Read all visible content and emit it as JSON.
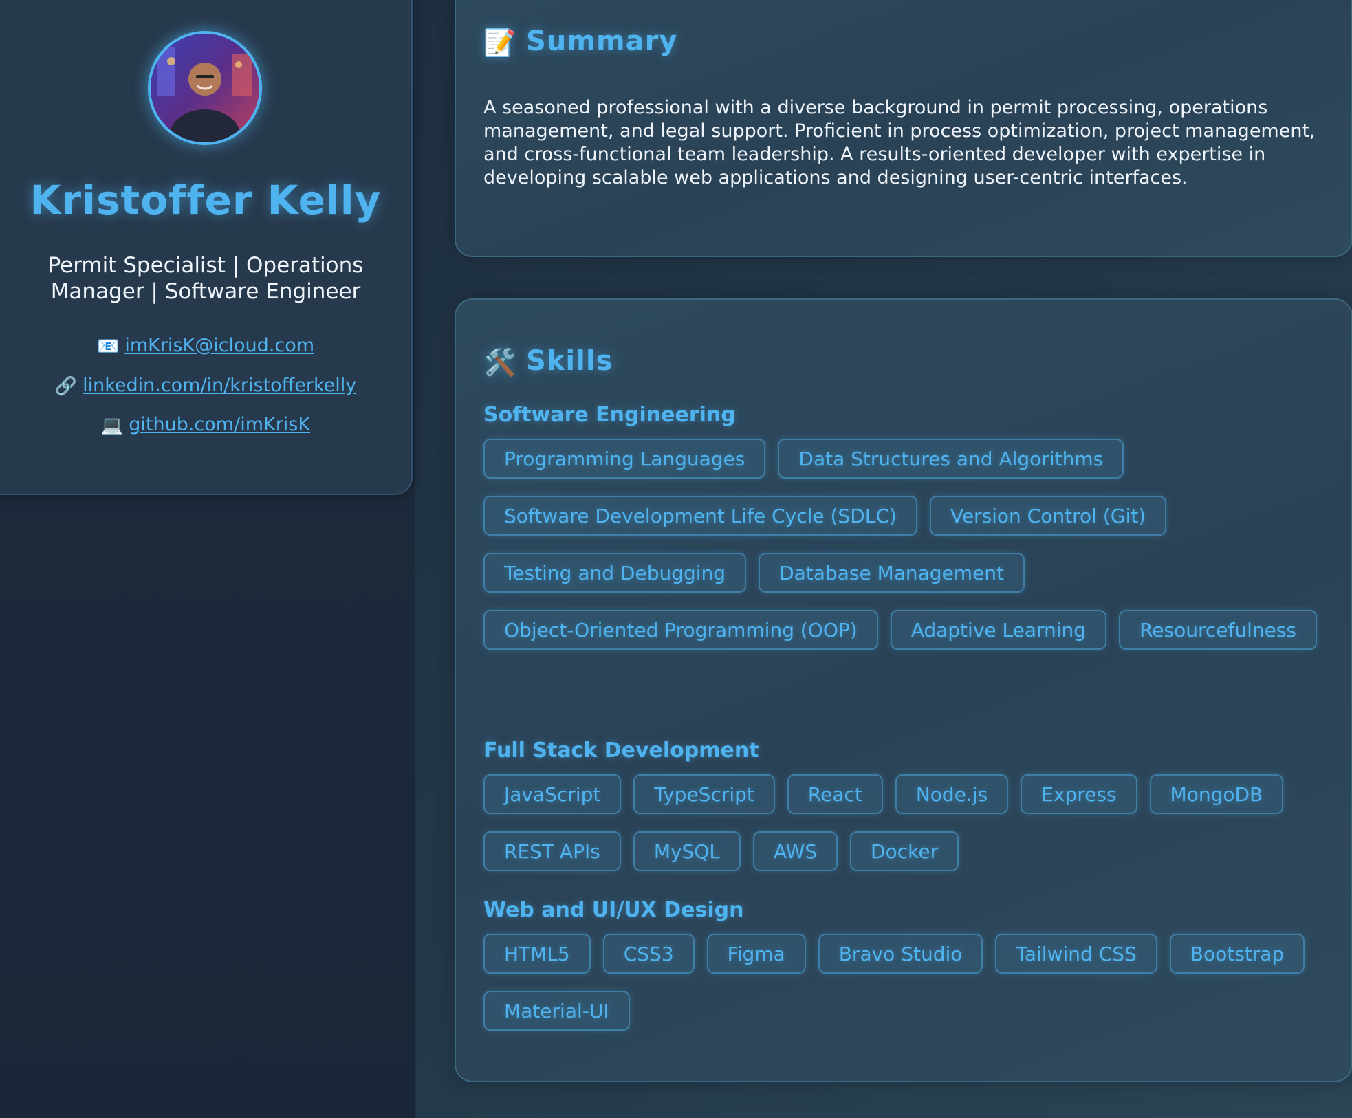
{
  "profile": {
    "name": "Kristoffer Kelly",
    "tagline": "Permit Specialist | Operations Manager | Software Engineer",
    "avatar_alt": "profile photo",
    "contacts": {
      "email": {
        "icon": "envelope-icon",
        "glyph": "📧",
        "label": "imKrisK@icloud.com"
      },
      "linkedin": {
        "icon": "link-icon",
        "glyph": "🔗",
        "label": "linkedin.com/in/kristofferkelly"
      },
      "github": {
        "icon": "laptop-icon",
        "glyph": "💻",
        "label": "github.com/imKrisK"
      }
    }
  },
  "summary": {
    "icon": "memo-icon",
    "glyph": "📝",
    "title": "Summary",
    "text": "A seasoned professional with a diverse background in permit processing, operations management, and legal support. Proficient in process optimization, project management, and cross-functional team leadership. A results-oriented developer with expertise in developing scalable web applications and designing user-centric interfaces."
  },
  "skills": {
    "icon": "hammer-wrench-icon",
    "glyph": "🛠️",
    "title": "Skills",
    "groups": [
      {
        "title": "Software Engineering",
        "items": [
          "Programming Languages",
          "Data Structures and Algorithms",
          "Software Development Life Cycle (SDLC)",
          "Version Control (Git)",
          "Testing and Debugging",
          "Database Management",
          "Object-Oriented Programming (OOP)",
          "Adaptive Learning",
          "Resourcefulness"
        ]
      },
      {
        "title": "Full Stack Development",
        "items": [
          "JavaScript",
          "TypeScript",
          "React",
          "Node.js",
          "Express",
          "MongoDB",
          "REST APIs",
          "MySQL",
          "AWS",
          "Docker"
        ]
      },
      {
        "title": "Web and UI/UX Design",
        "items": [
          "HTML5",
          "CSS3",
          "Figma",
          "Bravo Studio",
          "Tailwind CSS",
          "Bootstrap",
          "Material-UI"
        ]
      }
    ]
  },
  "colors": {
    "accent": "#4fb3f0",
    "background": "#1c2b3c",
    "card": "#2e4a5e",
    "text": "#eef4fa"
  }
}
